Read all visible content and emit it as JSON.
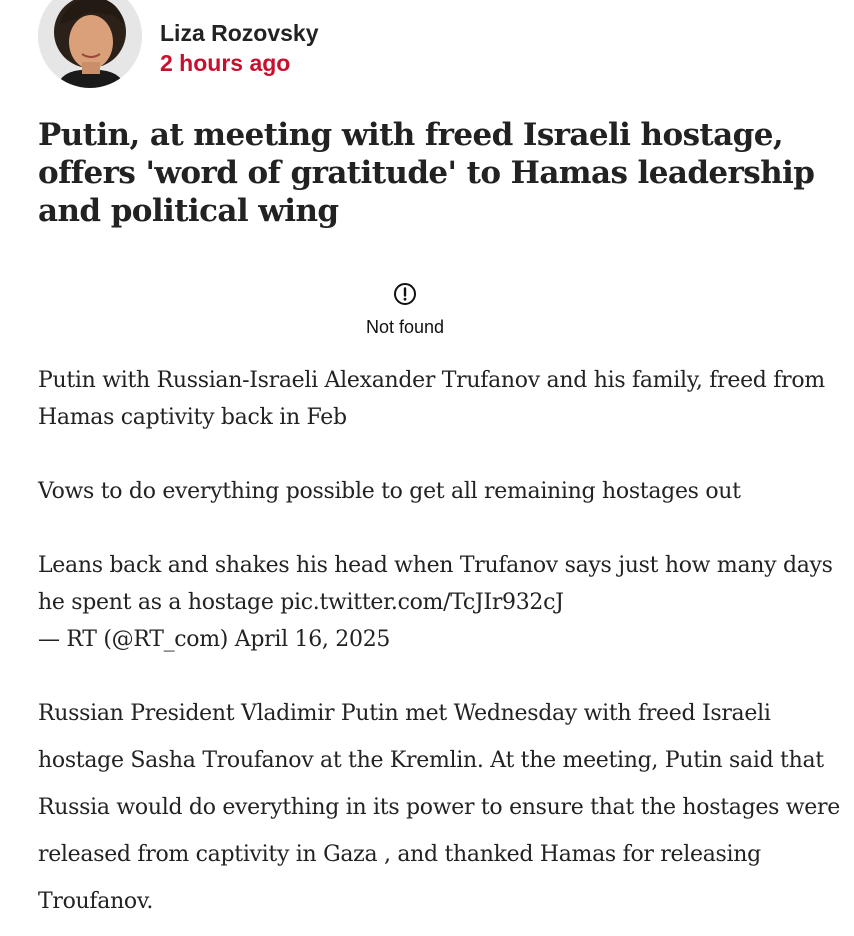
{
  "author": {
    "name": "Liza Rozovsky",
    "time": "2 hours ago"
  },
  "article": {
    "headline": "Putin, at meeting with freed Israeli hostage, offers 'word of gratitude' to Hamas leadership and political wing"
  },
  "embed": {
    "error_icon": "alert-circle-icon",
    "error_text": "Not found"
  },
  "tweet": {
    "line1": "Putin with Russian-Israeli Alexander Trufanov and his family, freed from Hamas captivity back in Feb",
    "line2": "Vows to do everything possible to get all remaining hostages out",
    "line3_text": "Leans back and shakes his head when Trufanov says just how many days he spent as a hostage ",
    "line3_link": "pic.twitter.com/TcJIr932cJ",
    "attribution": "— RT (@RT_com) April 16, 2025"
  },
  "body": {
    "paragraph": "Russian President Vladimir Putin met Wednesday with freed Israeli hostage Sasha Troufanov at the Kremlin. At the meeting, Putin said that Russia would do everything in its power to ensure that the hostages were released from captivity in Gaza , and thanked Hamas for releasing Troufanov."
  },
  "colors": {
    "accent": "#c8102e",
    "text": "#222222"
  }
}
